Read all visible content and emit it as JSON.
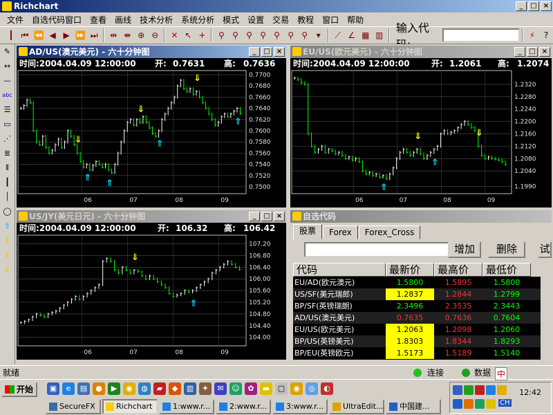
{
  "app": {
    "title": "Richchart"
  },
  "menu": [
    "文件",
    "自选代码窗口",
    "查看",
    "画线",
    "技术分析",
    "系统分析",
    "模式",
    "设置",
    "交易",
    "教程",
    "窗口",
    "帮助"
  ],
  "toolbar": {
    "code_label": "输入代码:",
    "code_value": ""
  },
  "charts": [
    {
      "title": "AD/US(澳元美元) - 六十分钟图",
      "time": "时间:2004.04.09 12:00:00",
      "open_label": "开:",
      "open": "0.7631",
      "high_label": "高:",
      "high": "0.7636",
      "ticks": [
        "0.7700",
        "0.7680",
        "0.7660",
        "0.7640",
        "0.7620",
        "0.7600",
        "0.7580",
        "0.7560",
        "0.7540",
        "0.7520",
        "0.7500"
      ],
      "xlabels": [
        "06",
        "07",
        "08",
        "09"
      ],
      "ymin": 0.7495,
      "ymax": 0.7705,
      "closes": [
        0.764,
        0.7645,
        0.7655,
        0.765,
        0.76,
        0.758,
        0.7575,
        0.759,
        0.757,
        0.756,
        0.7565,
        0.7575,
        0.7585,
        0.757,
        0.758,
        0.76,
        0.759,
        0.7575,
        0.756,
        0.7545,
        0.7535,
        0.754,
        0.753,
        0.7538,
        0.7545,
        0.754,
        0.7535,
        0.754,
        0.753,
        0.7525,
        0.754,
        0.756,
        0.758,
        0.76,
        0.7615,
        0.762,
        0.761,
        0.762,
        0.7615,
        0.7625,
        0.7615,
        0.7605,
        0.7595,
        0.759,
        0.76,
        0.762,
        0.763,
        0.764,
        0.765,
        0.766,
        0.768,
        0.769,
        0.7675,
        0.767,
        0.7675,
        0.7665,
        0.767,
        0.766,
        0.765,
        0.764,
        0.763,
        0.762,
        0.761,
        0.7615,
        0.7625,
        0.763,
        0.7625,
        0.763,
        0.7635,
        0.764,
        0.7631
      ]
    },
    {
      "title": "EU/US(欧元美元) - 六十分钟图",
      "time": "时间:2004.04.09 12:00:00",
      "open_label": "开:",
      "open": "1.2061",
      "high_label": "高:",
      "high": "1.2074",
      "ticks": [
        "1.2320",
        "1.2280",
        "1.2240",
        "1.2200",
        "1.2160",
        "1.2120",
        "1.2080",
        "1.2040",
        "1.1990"
      ],
      "xlabels": [
        "06",
        "07",
        "08",
        "09"
      ],
      "ymin": 1.198,
      "ymax": 1.236,
      "closes": [
        1.234,
        1.2335,
        1.2325,
        1.232,
        1.216,
        1.212,
        1.21,
        1.211,
        1.212,
        1.21,
        1.211,
        1.2105,
        1.2095,
        1.21,
        1.209,
        1.208,
        1.2085,
        1.2075,
        1.208,
        1.207,
        1.204,
        1.203,
        1.2035,
        1.2025,
        1.203,
        1.202,
        1.2025,
        1.2015,
        1.203,
        1.205,
        1.208,
        1.21,
        1.211,
        1.21,
        1.209,
        1.21,
        1.211,
        1.2095,
        1.208,
        1.209,
        1.21,
        1.211,
        1.212,
        1.216,
        1.217,
        1.216,
        1.2165,
        1.217,
        1.218,
        1.219,
        1.22,
        1.219,
        1.218,
        1.217,
        1.212,
        1.209,
        1.208,
        1.2085,
        1.208,
        1.2078,
        1.2075,
        1.207,
        1.2061
      ]
    },
    {
      "title": "US/JY(美元日元) - 六十分钟图",
      "time": "时间:2004.04.09 12:00:00",
      "open_label": "开:",
      "open": "106.32",
      "high_label": "高:",
      "high": "106.42",
      "ticks": [
        "107.20",
        "106.80",
        "106.40",
        "106.00",
        "105.60",
        "105.20",
        "104.80",
        "104.40",
        "104.00"
      ],
      "xlabels": [
        "06",
        "07",
        "08",
        "09"
      ],
      "ymin": 103.85,
      "ymax": 107.45,
      "closes": [
        104.5,
        104.55,
        104.6,
        104.7,
        104.8,
        104.75,
        104.7,
        104.8,
        104.85,
        104.9,
        105.0,
        105.1,
        105.2,
        105.3,
        105.4,
        105.3,
        105.4,
        105.5,
        105.6,
        105.7,
        105.8,
        106.6,
        106.7,
        106.6,
        106.3,
        106.2,
        106.4,
        106.3,
        106.2,
        106.3,
        106.25,
        106.1,
        106.0,
        106.1,
        106.0,
        105.9,
        105.8,
        105.7,
        105.5,
        105.4,
        105.45,
        105.5,
        105.6,
        105.55,
        105.6,
        105.7,
        105.8,
        105.9,
        106.0,
        106.2,
        106.3,
        106.4,
        106.5,
        106.6,
        106.5,
        106.4,
        106.32
      ]
    }
  ],
  "watchlist": {
    "title": "自选代码",
    "tabs": [
      "股票",
      "Forex",
      "Forex_Cross"
    ],
    "add_label": "增加",
    "delete_label": "删除",
    "more_label": "试",
    "columns": [
      "代码",
      "最新价",
      "最高价",
      "最低价"
    ],
    "rows": [
      {
        "code": "EU/AD(欧元澳元)",
        "last": "1.5800",
        "high": "1.5895",
        "low": "1.5800",
        "lc": "#00ff00",
        "hc": "#ff3030",
        "lwc": "#00ff00",
        "bg": ""
      },
      {
        "code": "US/SF(美元瑞郎)",
        "last": "1.2837",
        "high": "1.2844",
        "low": "1.2799",
        "lc": "#000000",
        "hc": "#ff3030",
        "lwc": "#00ff00",
        "bg": "#ffff00"
      },
      {
        "code": "BP/SF(英镑瑞朗)",
        "last": "2.3496",
        "high": "2.3535",
        "low": "2.3443",
        "lc": "#00ff00",
        "hc": "#ff3030",
        "lwc": "#00ff00",
        "bg": ""
      },
      {
        "code": "AD/US(澳元美元)",
        "last": "0.7635",
        "high": "0.7636",
        "low": "0.7604",
        "lc": "#ff3030",
        "hc": "#ff3030",
        "lwc": "#00ff00",
        "bg": ""
      },
      {
        "code": "EU/US(欧元美元)",
        "last": "1.2063",
        "high": "1.2098",
        "low": "1.2060",
        "lc": "#000000",
        "hc": "#ff3030",
        "lwc": "#00ff00",
        "bg": "#ffff00"
      },
      {
        "code": "BP/US(英镑美元)",
        "last": "1.8303",
        "high": "1.8344",
        "low": "1.8293",
        "lc": "#000000",
        "hc": "#ff3030",
        "lwc": "#00ff00",
        "bg": "#ffff00"
      },
      {
        "code": "BP/EU(英镑欧元)",
        "last": "1.5173",
        "high": "1.5189",
        "low": "1.5140",
        "lc": "#000000",
        "hc": "#ff3030",
        "lwc": "#00ff00",
        "bg": "#ffff00"
      }
    ]
  },
  "status": {
    "ready": "就绪",
    "connect": "连接",
    "data": "数据"
  },
  "taskbar": {
    "start": "开始",
    "tasks": [
      "SecureFX",
      "Richchart",
      "1:www.r...",
      "2:www.r...",
      "3:www.r...",
      "UltraEdit...",
      "中国建..."
    ],
    "clock": "12:42",
    "ime": "中",
    "ime2": "CH"
  }
}
